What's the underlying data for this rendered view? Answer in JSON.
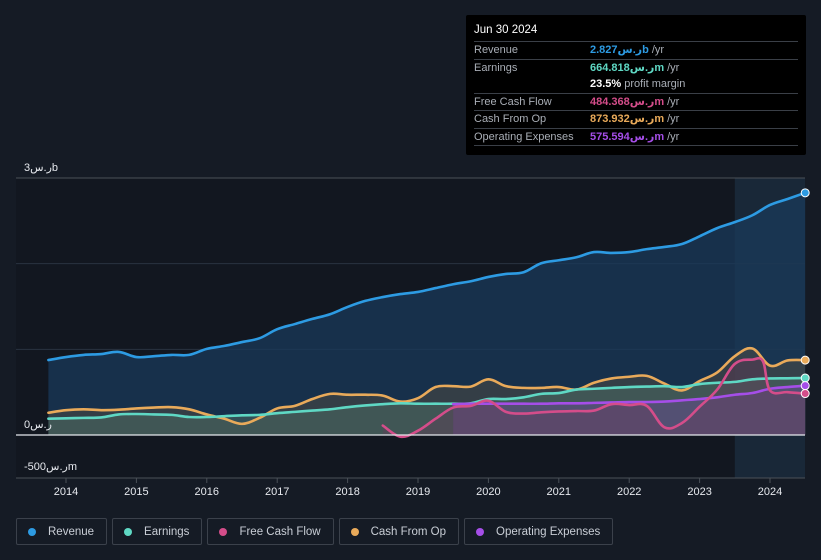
{
  "tooltip": {
    "date": "Jun 30 2024",
    "rows": [
      {
        "label": "Revenue",
        "value": "2.827ر.سb",
        "unit": "/yr",
        "color": "#2d9be3"
      },
      {
        "label": "Earnings",
        "value": "664.818ر.سm",
        "unit": "/yr",
        "color": "#5fd8c4"
      },
      {
        "label": "",
        "margin_value": "23.5%",
        "margin_text": "profit margin"
      },
      {
        "label": "Free Cash Flow",
        "value": "484.368ر.سm",
        "unit": "/yr",
        "color": "#d44d8a"
      },
      {
        "label": "Cash From Op",
        "value": "873.932ر.سm",
        "unit": "/yr",
        "color": "#e9aa5a"
      },
      {
        "label": "Operating Expenses",
        "value": "575.594ر.سm",
        "unit": "/yr",
        "color": "#a54ee8"
      }
    ]
  },
  "legend": [
    {
      "label": "Revenue",
      "color": "#2d9be3"
    },
    {
      "label": "Earnings",
      "color": "#5fd8c4"
    },
    {
      "label": "Free Cash Flow",
      "color": "#d44d8a"
    },
    {
      "label": "Cash From Op",
      "color": "#e9aa5a"
    },
    {
      "label": "Operating Expenses",
      "color": "#a54ee8"
    }
  ],
  "chart_data": {
    "type": "area",
    "title": "",
    "xlabel": "",
    "ylabel": "",
    "units": "ر.س millions",
    "y_tick_labels": [
      {
        "value": 3000,
        "label": "3ر.سb"
      },
      {
        "value": 0,
        "label": "0ر.س"
      },
      {
        "value": -500,
        "label": "-500ر.سm"
      }
    ],
    "ylim": [
      -500,
      3000
    ],
    "gridlines": [
      3000,
      2000,
      1000,
      0
    ],
    "x_ticks": [
      "2014",
      "2015",
      "2016",
      "2017",
      "2018",
      "2019",
      "2020",
      "2021",
      "2022",
      "2023",
      "2024"
    ],
    "xlim": [
      2013.25,
      2024.75
    ],
    "highlight_range": [
      2023.5,
      2024.5
    ],
    "series": [
      {
        "name": "Revenue",
        "color": "#2d9be3",
        "x": [
          2013.75,
          2014.0,
          2014.25,
          2014.5,
          2014.75,
          2015.0,
          2015.25,
          2015.5,
          2015.75,
          2016.0,
          2016.25,
          2016.5,
          2016.75,
          2017.0,
          2017.25,
          2017.5,
          2017.75,
          2018.0,
          2018.25,
          2018.5,
          2018.75,
          2019.0,
          2019.25,
          2019.5,
          2019.75,
          2020.0,
          2020.25,
          2020.5,
          2020.75,
          2021.0,
          2021.25,
          2021.5,
          2021.75,
          2022.0,
          2022.25,
          2022.5,
          2022.75,
          2023.0,
          2023.25,
          2023.5,
          2023.75,
          2024.0,
          2024.25,
          2024.5
        ],
        "values": [
          875,
          910,
          935,
          945,
          970,
          910,
          920,
          935,
          935,
          1005,
          1040,
          1085,
          1130,
          1235,
          1295,
          1355,
          1410,
          1495,
          1565,
          1610,
          1645,
          1670,
          1715,
          1760,
          1795,
          1845,
          1880,
          1900,
          2005,
          2040,
          2075,
          2135,
          2125,
          2135,
          2170,
          2195,
          2230,
          2320,
          2415,
          2485,
          2565,
          2685,
          2755,
          2827
        ]
      },
      {
        "name": "Earnings",
        "color": "#5fd8c4",
        "x": [
          2013.75,
          2014.0,
          2014.25,
          2014.5,
          2014.75,
          2015.0,
          2015.25,
          2015.5,
          2015.75,
          2016.0,
          2016.25,
          2016.5,
          2016.75,
          2017.0,
          2017.25,
          2017.5,
          2017.75,
          2018.0,
          2018.25,
          2018.5,
          2018.75,
          2019.0,
          2019.25,
          2019.5,
          2019.75,
          2020.0,
          2020.25,
          2020.5,
          2020.75,
          2021.0,
          2021.25,
          2021.5,
          2021.75,
          2022.0,
          2022.25,
          2022.5,
          2022.75,
          2023.0,
          2023.25,
          2023.5,
          2023.75,
          2024.0,
          2024.25,
          2024.5
        ],
        "values": [
          190,
          195,
          200,
          205,
          240,
          245,
          240,
          235,
          210,
          210,
          220,
          230,
          235,
          255,
          270,
          285,
          300,
          325,
          345,
          360,
          370,
          365,
          365,
          365,
          370,
          420,
          420,
          440,
          480,
          490,
          530,
          540,
          550,
          560,
          565,
          570,
          560,
          595,
          610,
          620,
          650,
          660,
          662,
          665
        ]
      },
      {
        "name": "Free Cash Flow",
        "color": "#d44d8a",
        "x": [
          2018.5,
          2018.75,
          2019.0,
          2019.25,
          2019.5,
          2019.75,
          2020.0,
          2020.25,
          2020.5,
          2020.75,
          2021.0,
          2021.25,
          2021.5,
          2021.75,
          2022.0,
          2022.25,
          2022.5,
          2022.75,
          2023.0,
          2023.25,
          2023.5,
          2023.75,
          2023.9,
          2024.0,
          2024.25,
          2024.5
        ],
        "values": [
          110,
          -20,
          50,
          190,
          320,
          340,
          400,
          270,
          250,
          265,
          275,
          280,
          285,
          360,
          350,
          340,
          90,
          140,
          330,
          530,
          830,
          880,
          860,
          520,
          500,
          484
        ]
      },
      {
        "name": "Cash From Op",
        "color": "#e9aa5a",
        "x": [
          2013.75,
          2014.0,
          2014.25,
          2014.5,
          2014.75,
          2015.0,
          2015.25,
          2015.5,
          2015.75,
          2016.0,
          2016.25,
          2016.5,
          2016.75,
          2017.0,
          2017.25,
          2017.5,
          2017.75,
          2018.0,
          2018.25,
          2018.5,
          2018.75,
          2019.0,
          2019.25,
          2019.5,
          2019.75,
          2020.0,
          2020.25,
          2020.5,
          2020.75,
          2021.0,
          2021.25,
          2021.5,
          2021.75,
          2022.0,
          2022.25,
          2022.5,
          2022.75,
          2023.0,
          2023.25,
          2023.5,
          2023.75,
          2024.0,
          2024.25,
          2024.5
        ],
        "values": [
          260,
          290,
          300,
          290,
          295,
          310,
          320,
          325,
          300,
          240,
          190,
          130,
          200,
          310,
          340,
          420,
          480,
          470,
          470,
          460,
          390,
          430,
          560,
          570,
          565,
          650,
          570,
          550,
          550,
          560,
          530,
          610,
          660,
          680,
          690,
          600,
          520,
          630,
          730,
          920,
          1010,
          810,
          870,
          874
        ]
      },
      {
        "name": "Operating Expenses",
        "color": "#a54ee8",
        "x": [
          2019.5,
          2019.75,
          2020.0,
          2020.25,
          2020.5,
          2020.75,
          2021.0,
          2021.25,
          2021.5,
          2021.75,
          2022.0,
          2022.25,
          2022.5,
          2022.75,
          2023.0,
          2023.25,
          2023.5,
          2023.75,
          2024.0,
          2024.25,
          2024.5
        ],
        "values": [
          360,
          365,
          365,
          365,
          365,
          365,
          370,
          370,
          375,
          380,
          385,
          385,
          390,
          405,
          420,
          440,
          470,
          490,
          540,
          560,
          576
        ]
      }
    ]
  }
}
